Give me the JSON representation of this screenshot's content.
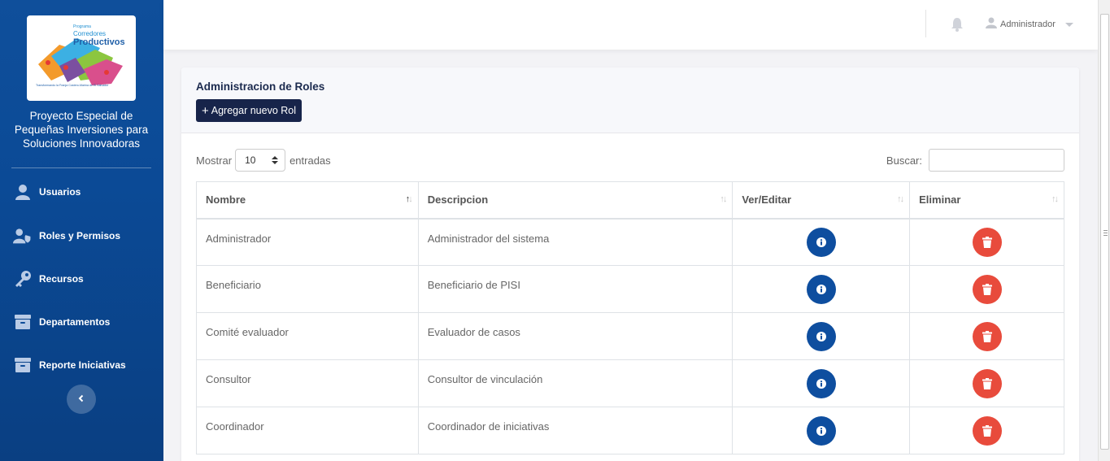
{
  "sidebar": {
    "logo": {
      "line1": "Programa",
      "line2": "Corredores",
      "line3": "Productivos",
      "tagline": "Transformando la Franja Costero-Marina de El Salvador"
    },
    "project_name": "Proyecto Especial de Pequeñas Inversiones para Soluciones Innovadoras",
    "items": [
      {
        "label": "Usuarios",
        "icon": "user-icon"
      },
      {
        "label": "Roles y Permisos",
        "icon": "user-shield-icon"
      },
      {
        "label": "Recursos",
        "icon": "key-icon"
      },
      {
        "label": "Departamentos",
        "icon": "archive-icon"
      },
      {
        "label": "Reporte Iniciativas",
        "icon": "archive-icon"
      }
    ],
    "collapse_icon": "chevron-left-icon"
  },
  "topbar": {
    "notification_icon": "bell-icon",
    "user_name": "Administrador",
    "user_icon": "user-icon"
  },
  "card": {
    "title": "Administracion de Roles",
    "add_button_label": "Agregar nuevo Rol"
  },
  "table_controls": {
    "show_label": "Mostrar",
    "entries_value": "10",
    "entries_label": "entradas",
    "search_label": "Buscar:",
    "search_value": ""
  },
  "table": {
    "headers": [
      "Nombre",
      "Descripcion",
      "Ver/Editar",
      "Eliminar"
    ],
    "rows": [
      {
        "nombre": "Administrador",
        "descripcion": "Administrador del sistema"
      },
      {
        "nombre": "Beneficiario",
        "descripcion": "Beneficiario de PISI"
      },
      {
        "nombre": "Comité evaluador",
        "descripcion": "Evaluador de casos"
      },
      {
        "nombre": "Consultor",
        "descripcion": "Consultor de vinculación"
      },
      {
        "nombre": "Coordinador",
        "descripcion": "Coordinador de iniciativas"
      }
    ]
  },
  "colors": {
    "sidebar": "#0b4a96",
    "primary_button": "#17244a",
    "info_button": "#0e4e9f",
    "delete_button": "#e84b3c"
  }
}
